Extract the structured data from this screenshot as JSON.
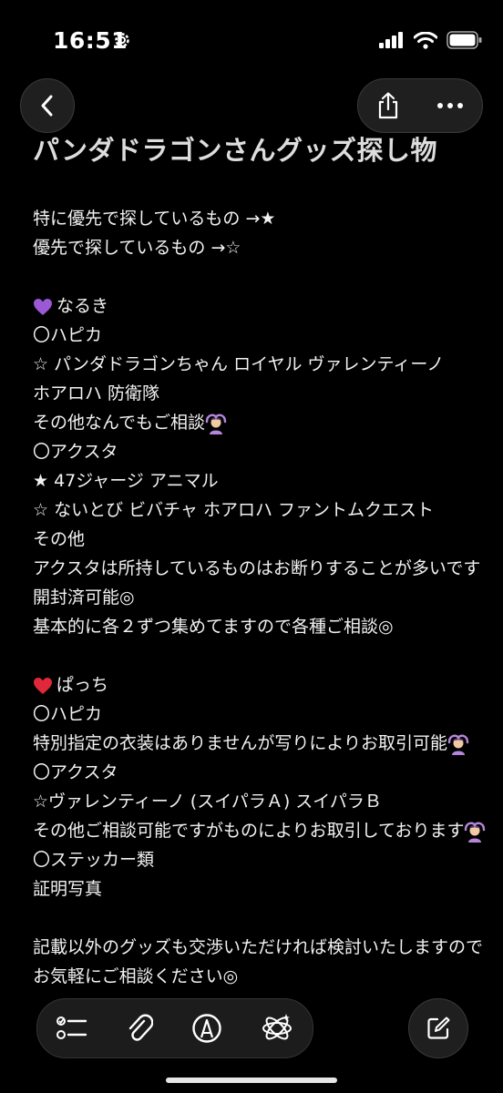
{
  "status_bar": {
    "time": "16:51"
  },
  "note": {
    "title": "パンダドラゴンさんグッズ探し物",
    "lines": [
      "特に優先で探しているもの →★",
      "優先で探しているもの →☆",
      "",
      "なるき",
      "〇ハピカ",
      "☆ パンダドラゴンちゃん ロイヤル ヴァレンティーノ",
      "ホアロハ 防衛隊",
      "その他なんでもご相談",
      "〇アクスタ",
      "★ 47ジャージ アニマル",
      "☆ ないとび ビバチャ ホアロハ ファントムクエスト",
      "その他",
      "アクスタは所持しているものはお断りすることが多いです",
      "開封済可能◎",
      "基本的に各２ずつ集めてますので各種ご相談◎",
      "",
      "ぱっち",
      "〇ハピカ",
      "特別指定の衣装はありませんが写りによりお取引可能",
      "〇アクスタ",
      "☆ヴァレンティーノ (スイパラＡ) スイパラＢ",
      "その他ご相談可能ですがものによりお取引しております",
      "〇ステッカー類",
      "証明写真",
      "",
      "記載以外のグッズも交渉いただければ検討いたしますので",
      "お気軽にご相談ください◎"
    ]
  },
  "icons": {
    "back": "chevron-left-icon",
    "share": "share-icon",
    "more": "ellipsis-icon",
    "checklist": "checklist-icon",
    "attachment": "paperclip-icon",
    "markup": "pen-circle-icon",
    "ai": "apple-intelligence-icon",
    "compose": "compose-icon"
  },
  "colors": {
    "background": "#000000",
    "text": "#f2f2f2",
    "purple_heart": "#9b59d6",
    "red_heart": "#e0283a"
  }
}
